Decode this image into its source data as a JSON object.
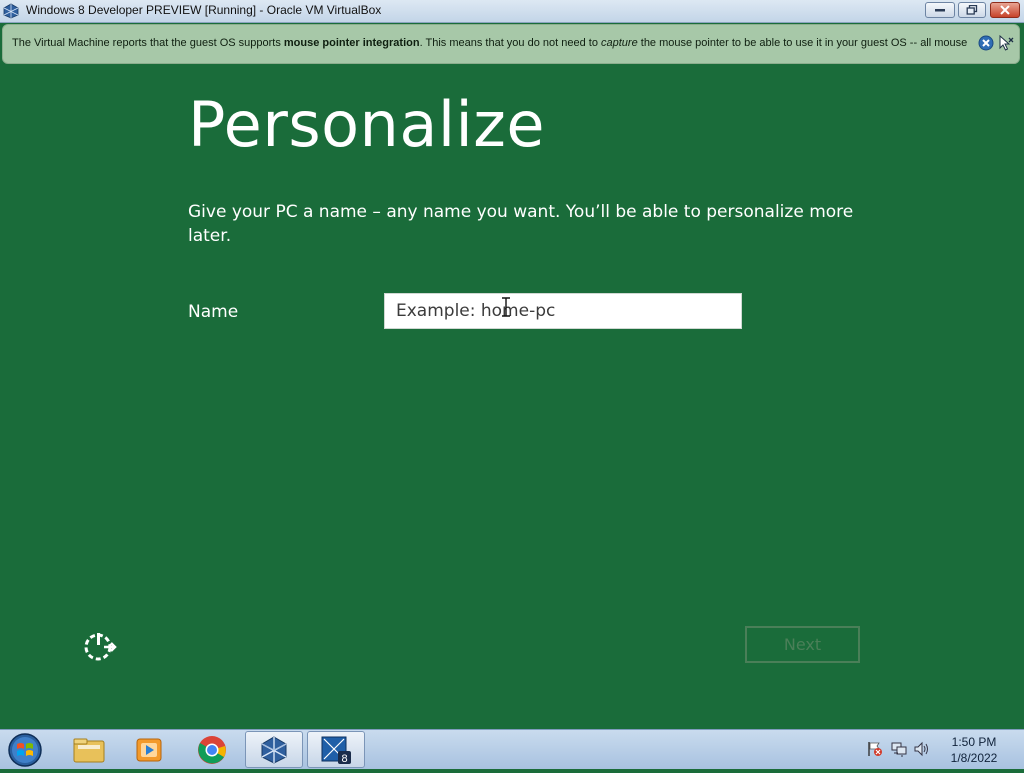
{
  "window": {
    "title": "Windows 8 Developer PREVIEW [Running] - Oracle VM VirtualBox",
    "app_icon": "virtualbox-icon",
    "controls": [
      "minimize-icon",
      "maximize-icon",
      "close-icon"
    ]
  },
  "notification": {
    "text_1": "The Virtual Machine reports that the guest OS supports ",
    "text_bold": "mouse pointer integration",
    "text_2": ". This means that you do not need to ",
    "text_italic": "capture",
    "text_3": " the mouse pointer to be able to use it in your guest OS -- all mouse",
    "close_icon": "close-circle-icon",
    "mouse_icon": "mouse-integration-icon"
  },
  "setup": {
    "heading": "Personalize",
    "description": "Give your PC a name – any name you want. You’ll be able to personalize more later.",
    "name_label": "Name",
    "name_placeholder": "Example: home-pc",
    "name_value": "",
    "ease_of_access_icon": "ease-of-access-icon",
    "next_label": "Next",
    "colors": {
      "background": "#1a6c3a",
      "text": "#ffffff",
      "next_disabled": "#4a7f58"
    }
  },
  "taskbar": {
    "start_icon": "windows-start-orb-icon",
    "apps": [
      {
        "name": "file-explorer-icon",
        "active": false
      },
      {
        "name": "media-player-icon",
        "active": false
      },
      {
        "name": "chrome-icon",
        "active": false
      },
      {
        "name": "virtualbox-icon",
        "active": true
      },
      {
        "name": "windows8-vm-icon",
        "active": true
      }
    ],
    "tray_icons": [
      "action-center-flag-icon",
      "network-icon",
      "volume-icon"
    ],
    "time": "1:50 PM",
    "date": "1/8/2022"
  }
}
